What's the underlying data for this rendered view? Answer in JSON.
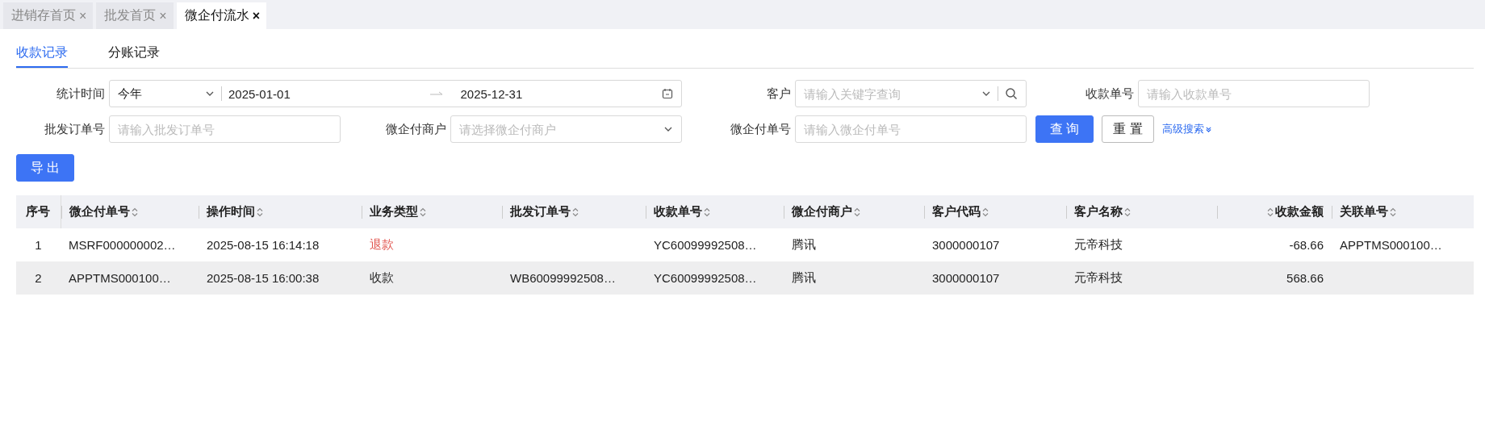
{
  "page_tabs": [
    {
      "label": "进销存首页",
      "selected": false,
      "close": "×"
    },
    {
      "label": "批发首页",
      "selected": false,
      "close": "×"
    },
    {
      "label": "微企付流水",
      "selected": true,
      "close": "×"
    }
  ],
  "sub_tabs": [
    {
      "label": "收款记录",
      "selected": true
    },
    {
      "label": "分账记录",
      "selected": false
    }
  ],
  "filters": {
    "period": {
      "label": "统计时间",
      "preset": "今年",
      "start": "2025-01-01",
      "end": "2025-12-31"
    },
    "customer": {
      "label": "客户",
      "placeholder": "请输入关键字查询"
    },
    "receipt_no": {
      "label": "收款单号",
      "placeholder": "请输入收款单号"
    },
    "order_no": {
      "label": "批发订单号",
      "placeholder": "请输入批发订单号"
    },
    "merchant": {
      "label": "微企付商户",
      "placeholder": "请选择微企付商户"
    },
    "wqf_no": {
      "label": "微企付单号",
      "placeholder": "请输入微企付单号"
    },
    "query": "查 询",
    "reset": "重 置",
    "advanced": "高级搜索"
  },
  "export": "导 出",
  "table": {
    "columns": [
      {
        "label": "序号",
        "sortable": false,
        "kind": "index"
      },
      {
        "label": "微企付单号",
        "sortable": true,
        "kind": "text"
      },
      {
        "label": "操作时间",
        "sortable": true,
        "kind": "text"
      },
      {
        "label": "业务类型",
        "sortable": true,
        "kind": "text"
      },
      {
        "label": "批发订单号",
        "sortable": true,
        "kind": "text"
      },
      {
        "label": "收款单号",
        "sortable": true,
        "kind": "text"
      },
      {
        "label": "微企付商户",
        "sortable": true,
        "kind": "text"
      },
      {
        "label": "客户代码",
        "sortable": true,
        "kind": "text"
      },
      {
        "label": "客户名称",
        "sortable": true,
        "kind": "text"
      },
      {
        "label": "收款金额",
        "sortable": true,
        "kind": "amount"
      },
      {
        "label": "关联单号",
        "sortable": true,
        "kind": "text"
      }
    ],
    "rows": [
      {
        "selected": false,
        "kind": "refund",
        "cells": [
          "1",
          "MSRF000000002…",
          "2025-08-15 16:14:18",
          "退款",
          "",
          "YC60099992508…",
          "腾讯",
          "3000000107",
          "元帝科技",
          "-68.66",
          "APPTMS000100…"
        ]
      },
      {
        "selected": true,
        "kind": "receipt",
        "cells": [
          "2",
          "APPTMS000100…",
          "2025-08-15 16:00:38",
          "收款",
          "WB60099992508…",
          "YC60099992508…",
          "腾讯",
          "3000000107",
          "元帝科技",
          "568.66",
          ""
        ]
      }
    ]
  }
}
